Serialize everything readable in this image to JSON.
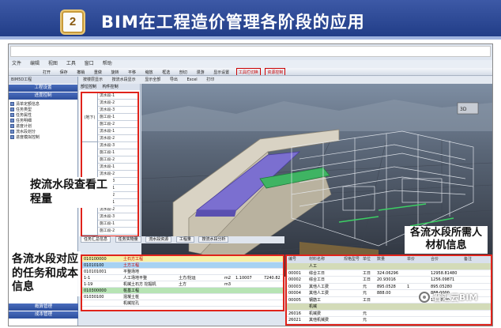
{
  "slide": {
    "number": "2",
    "title": "BIM在工程造价管理各阶段的应用"
  },
  "app": {
    "menu": [
      "文件",
      "编辑",
      "视图",
      "工具",
      "窗口",
      "帮助"
    ],
    "toolbar": [
      "打开",
      "保存",
      "撤销",
      "重做",
      "旋转",
      "平移",
      "缩放",
      "框选",
      "剖切",
      "漫游",
      "显示设置",
      "工具栏切换",
      "资源控制"
    ],
    "toolbar2": [
      "按楼层显示",
      "按流水段显示",
      "显示全部",
      "导出",
      "Excel",
      "打印"
    ],
    "nav_pane_title": "BIM5D工程",
    "nav_headers": {
      "top1": "工程设置",
      "top2": "进度控制",
      "bottom1": "概算管理",
      "bottom2": "成本管理"
    },
    "nav_items": [
      "清单定额信息",
      "任务类型",
      "任务属性",
      "任务明细",
      "进度计划",
      "流水段划分",
      "进度模拟控制"
    ]
  },
  "flow_panel": {
    "tabs": [
      "部位控制",
      "构件控制"
    ],
    "groups": [
      "(地下)",
      "(第1层)"
    ],
    "sections": [
      "流水段-1",
      "流水段-2",
      "流水段-3",
      "施工段-1",
      "施工段-2",
      "流水段-1",
      "流水段-2",
      "流水段-3",
      "施工段-1",
      "施工段-2",
      "流水段-1",
      "流水段-2",
      "流水段-3",
      "施工段-1",
      "施工段-2",
      "流水段-1",
      "流水段-2",
      "流水段-3",
      "施工段-1",
      "施工段-2"
    ]
  },
  "bottom_tabs": [
    "任务汇总信息",
    "任务实物量",
    "流水段资源",
    "工程量",
    "按流水段分析"
  ],
  "task_table": {
    "rows": [
      {
        "c1": "010100000",
        "c2": "土石方工程",
        "c3": "",
        "c4": "",
        "c5": "",
        "c6": "",
        "style": "hl1"
      },
      {
        "c1": "01010100",
        "c2": "土方工程",
        "c3": "",
        "c4": "",
        "c5": "",
        "c6": "",
        "style": "hl2"
      },
      {
        "c1": "010101001",
        "c2": "平整场地",
        "c3": "",
        "c4": "",
        "c5": "",
        "c6": "",
        "style": ""
      },
      {
        "c1": "1-1",
        "c2": "人工场地平整",
        "c3": "土方/挖运",
        "c4": "m2",
        "c5": "1.10007",
        "c6": "7240.82",
        "style": ""
      },
      {
        "c1": "1-19",
        "c2": "机械土石方 挖掘机",
        "c3": "土方",
        "c4": "m3",
        "c5": "",
        "c6": "",
        "style": ""
      },
      {
        "c1": "010300000",
        "c2": "桩基工程",
        "c3": "",
        "c4": "",
        "c5": "",
        "c6": "",
        "style": "hl3"
      },
      {
        "c1": "01030100",
        "c2": "混凝土桩",
        "c3": "",
        "c4": "",
        "c5": "",
        "c6": "",
        "style": ""
      },
      {
        "c1": "",
        "c2": "机械挖孔",
        "c3": "",
        "c4": "",
        "c5": "",
        "c6": "",
        "style": ""
      }
    ]
  },
  "resource_table": {
    "headers": [
      "编号",
      "材料名称",
      "规格型号",
      "单位",
      "数量",
      "单价",
      "合价",
      "备注"
    ],
    "rows": [
      {
        "cells": [
          "",
          "人工",
          "",
          "",
          "",
          "",
          "",
          ""
        ],
        "group": true
      },
      {
        "cells": [
          "00001",
          "综合工日",
          "",
          "工日",
          "324.06296",
          "",
          "12958.81480",
          ""
        ],
        "group": false
      },
      {
        "cells": [
          "00002",
          "综合工日",
          "",
          "工日",
          "20.93016",
          "",
          "1256.09871",
          ""
        ],
        "group": false
      },
      {
        "cells": [
          "00003",
          "其他人工费",
          "",
          "元",
          "895.0528",
          "1",
          "895.05280",
          ""
        ],
        "group": false
      },
      {
        "cells": [
          "00004",
          "其他人工费",
          "",
          "元",
          "888.00",
          "",
          "888.0000",
          ""
        ],
        "group": false
      },
      {
        "cells": [
          "00005",
          "钢筋工",
          "",
          "工日",
          "",
          "",
          "13559.20",
          ""
        ],
        "group": false
      },
      {
        "cells": [
          "",
          "机械",
          "",
          "",
          "",
          "",
          "",
          ""
        ],
        "group": true
      },
      {
        "cells": [
          "26016",
          "机械费",
          "",
          "元",
          "",
          "",
          "",
          ""
        ],
        "group": false
      },
      {
        "cells": [
          "26021",
          "其他机械费",
          "",
          "元",
          "",
          "",
          "",
          ""
        ],
        "group": false
      }
    ]
  },
  "callouts": {
    "quantity": "按流水段查看工程量",
    "resources": "各流水段所需人材机信息",
    "tasks": "各流水段对应的任务和成本信息"
  },
  "watermark": "晋汇云BIM"
}
